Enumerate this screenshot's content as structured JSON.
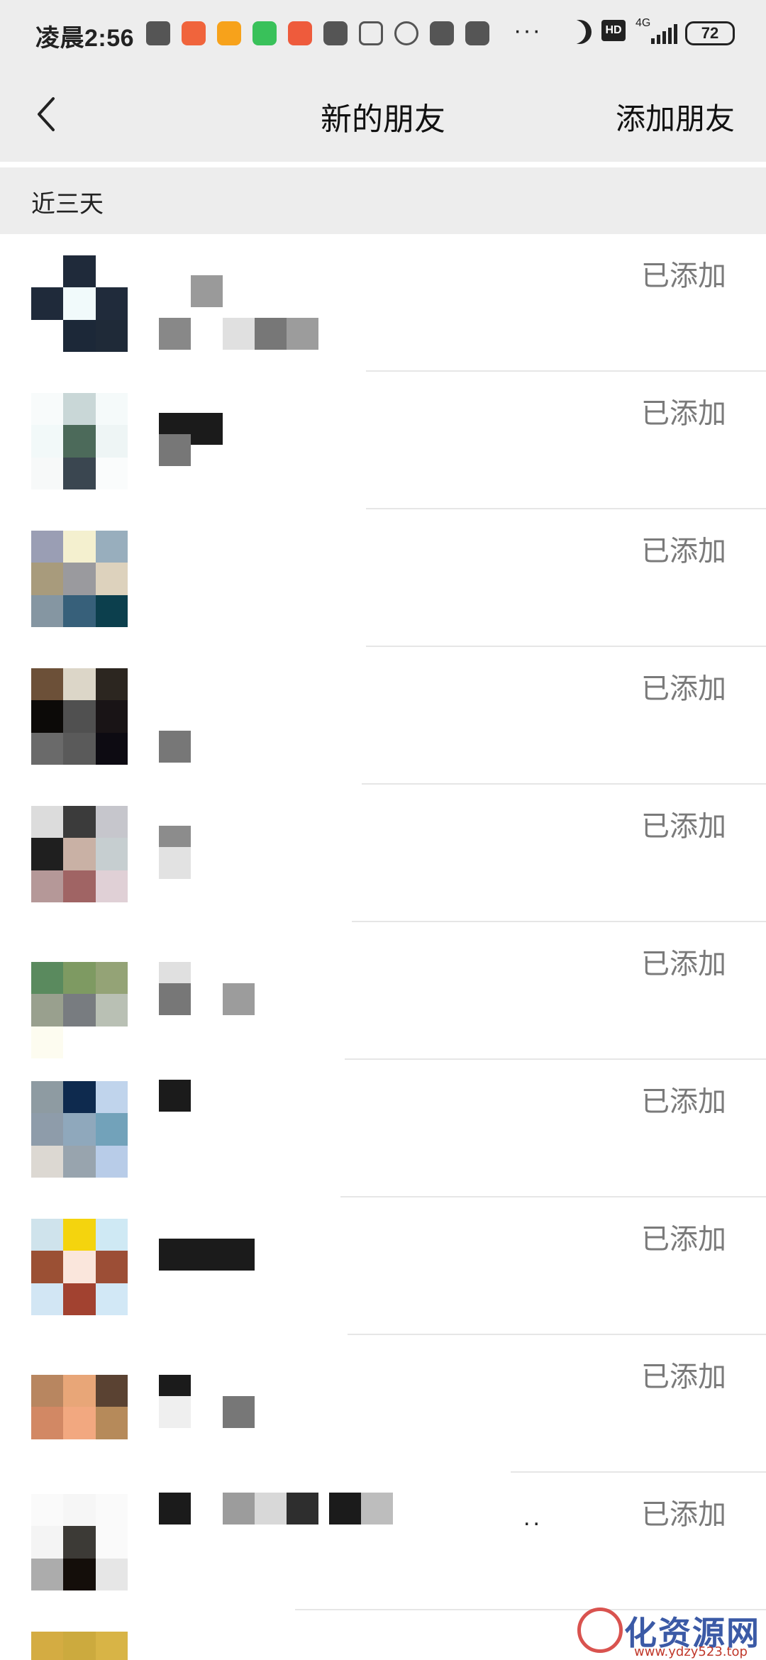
{
  "status_bar": {
    "time": "凌晨2:56",
    "dots": "···",
    "network": "4G",
    "hd": "HD",
    "battery": "72",
    "icons": [
      "message-icon",
      "app-orange-icon",
      "shield-icon",
      "wechat-icon",
      "app-red-icon",
      "upload-icon",
      "voicemail-icon",
      "alarm-icon",
      "mi-store-icon",
      "mi-store-icon",
      "moon-icon",
      "hd-icon",
      "signal-icon",
      "battery-icon"
    ]
  },
  "header": {
    "back_icon": "chevron-left-icon",
    "title": "新的朋友",
    "add_friend": "添加朋友"
  },
  "section": {
    "label": "近三天"
  },
  "friends": [
    {
      "status": "已添加"
    },
    {
      "status": "已添加"
    },
    {
      "status": "已添加"
    },
    {
      "status": "已添加"
    },
    {
      "status": "已添加"
    },
    {
      "status": "已添加"
    },
    {
      "status": "已添加"
    },
    {
      "status": "已添加"
    },
    {
      "status": "已添加"
    },
    {
      "status": "已添加",
      "extra": ".."
    },
    {
      "status": ""
    }
  ],
  "watermark": {
    "text": "化资源网",
    "url": "www.ydzy523.top"
  }
}
